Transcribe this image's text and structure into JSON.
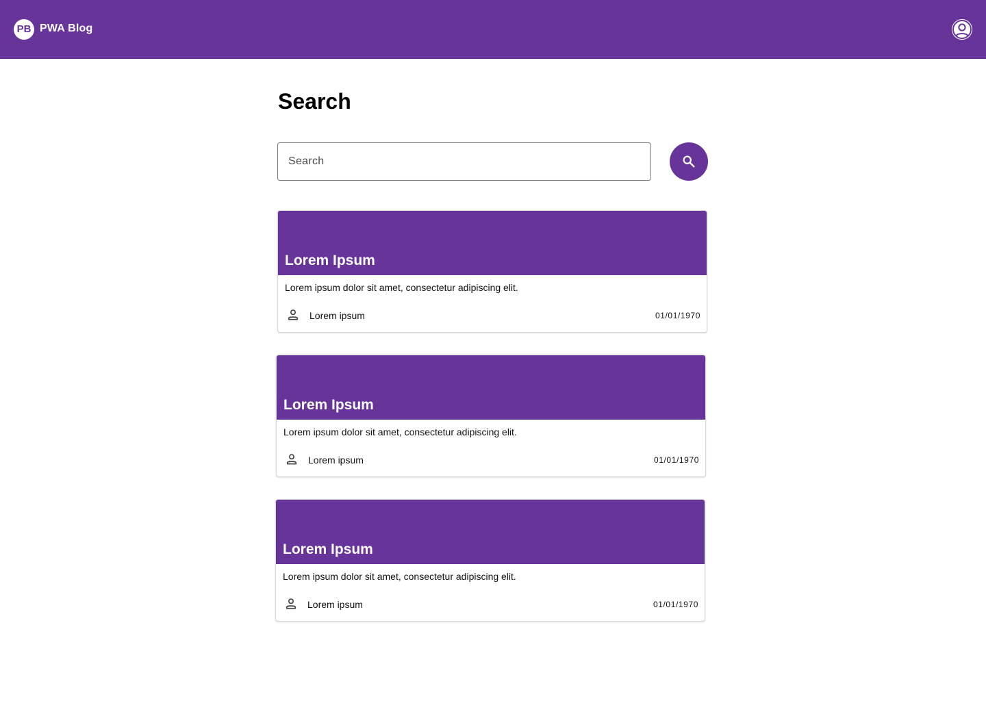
{
  "header": {
    "logo_text": "PB",
    "title": "PWA Blog",
    "account_icon": "account-circle-icon"
  },
  "page": {
    "title": "Search"
  },
  "search": {
    "placeholder": "Search",
    "value": "",
    "button_icon": "search-icon"
  },
  "posts": [
    {
      "title": "Lorem Ipsum",
      "description": "Lorem ipsum dolor sit amet, consectetur adipiscing elit.",
      "author": "Lorem ipsum",
      "date": "01/01/1970"
    },
    {
      "title": "Lorem Ipsum",
      "description": "Lorem ipsum dolor sit amet, consectetur adipiscing elit.",
      "author": "Lorem ipsum",
      "date": "01/01/1970"
    },
    {
      "title": "Lorem Ipsum",
      "description": "Lorem ipsum dolor sit amet, consectetur adipiscing elit.",
      "author": "Lorem ipsum",
      "date": "01/01/1970"
    }
  ],
  "colors": {
    "primary": "#673599",
    "on_primary": "#ffffff"
  }
}
